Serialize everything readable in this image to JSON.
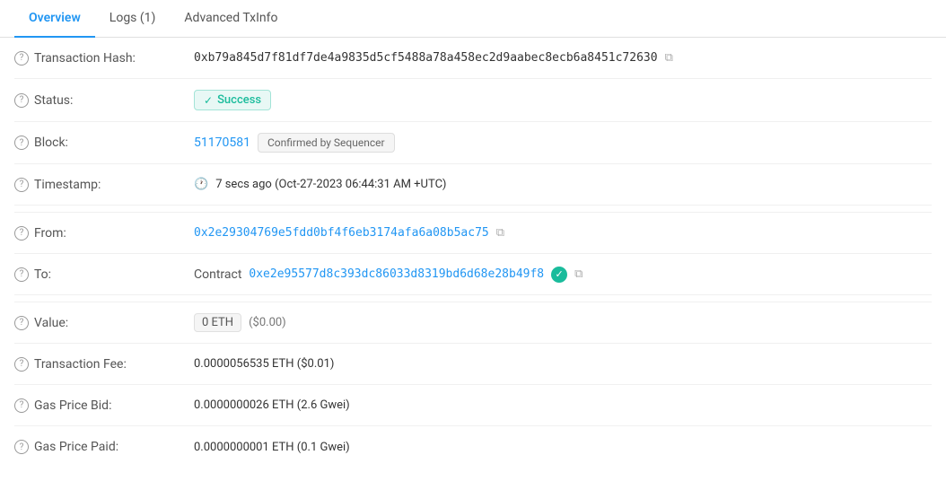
{
  "tabs": [
    {
      "id": "overview",
      "label": "Overview",
      "active": true
    },
    {
      "id": "logs",
      "label": "Logs (1)",
      "active": false
    },
    {
      "id": "advanced",
      "label": "Advanced TxInfo",
      "active": false
    }
  ],
  "rows": {
    "transaction_hash": {
      "label": "Transaction Hash:",
      "value": "0xb79a845d7f81df7de4a9835d5cf5488a78a458ec2d9aabec8ecb6a8451c72630"
    },
    "status": {
      "label": "Status:",
      "badge": "Success"
    },
    "block": {
      "label": "Block:",
      "block_number": "51170581",
      "sequencer_label": "Confirmed by Sequencer"
    },
    "timestamp": {
      "label": "Timestamp:",
      "value": "7 secs ago (Oct-27-2023 06:44:31 AM +UTC)"
    },
    "from": {
      "label": "From:",
      "value": "0x2e29304769e5fdd0bf4f6eb3174afa6a08b5ac75"
    },
    "to": {
      "label": "To:",
      "prefix": "Contract",
      "value": "0xe2e95577d8c393dc86033d8319bd6d68e28b49f8"
    },
    "value": {
      "label": "Value:",
      "eth_value": "0 ETH",
      "usd_value": "($0.00)"
    },
    "transaction_fee": {
      "label": "Transaction Fee:",
      "value": "0.0000056535 ETH ($0.01)"
    },
    "gas_price_bid": {
      "label": "Gas Price Bid:",
      "value": "0.0000000026 ETH (2.6 Gwei)"
    },
    "gas_price_paid": {
      "label": "Gas Price Paid:",
      "value": "0.0000000001 ETH (0.1 Gwei)"
    }
  },
  "icons": {
    "copy": "⧉",
    "clock": "🕐",
    "check": "✓"
  }
}
